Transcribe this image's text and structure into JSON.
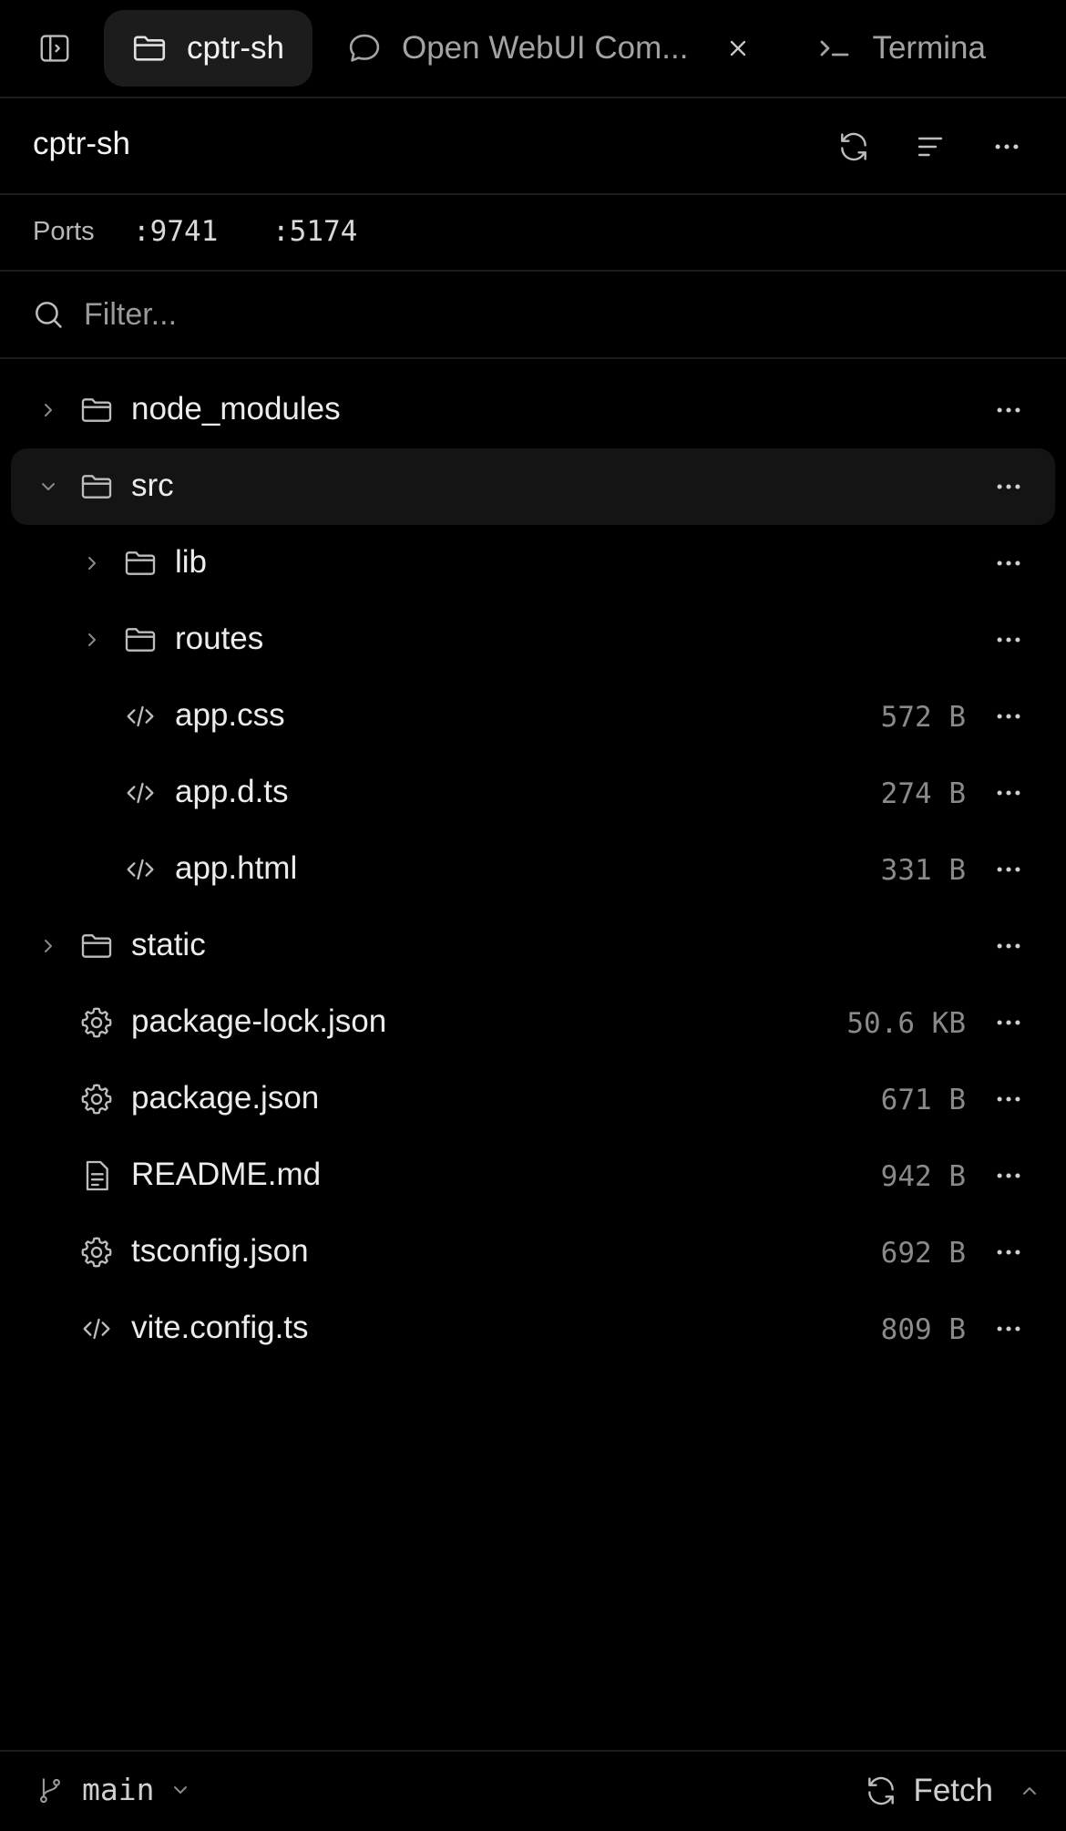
{
  "tabs": [
    {
      "label": "cptr-sh",
      "icon": "folder-icon",
      "active": true
    },
    {
      "label": "Open WebUI Com...",
      "icon": "chat-bubble-icon",
      "active": false,
      "closable": true
    },
    {
      "label": "Termina",
      "icon": "terminal-icon",
      "active": false
    }
  ],
  "header": {
    "title": "cptr-sh"
  },
  "ports": {
    "label": "Ports",
    "items": [
      ":9741",
      ":5174"
    ]
  },
  "filter": {
    "placeholder": "Filter...",
    "value": ""
  },
  "tree": [
    {
      "name": "node_modules",
      "type": "folder",
      "expanded": false,
      "depth": 0,
      "size": ""
    },
    {
      "name": "src",
      "type": "folder",
      "expanded": true,
      "depth": 0,
      "size": "",
      "selected": true
    },
    {
      "name": "lib",
      "type": "folder",
      "expanded": false,
      "depth": 1,
      "size": ""
    },
    {
      "name": "routes",
      "type": "folder",
      "expanded": false,
      "depth": 1,
      "size": ""
    },
    {
      "name": "app.css",
      "type": "code",
      "depth": 1,
      "size": "572 B"
    },
    {
      "name": "app.d.ts",
      "type": "code",
      "depth": 1,
      "size": "274 B"
    },
    {
      "name": "app.html",
      "type": "code",
      "depth": 1,
      "size": "331 B"
    },
    {
      "name": "static",
      "type": "folder",
      "expanded": false,
      "depth": 0,
      "size": ""
    },
    {
      "name": "package-lock.json",
      "type": "config",
      "depth": 0,
      "size": "50.6 KB"
    },
    {
      "name": "package.json",
      "type": "config",
      "depth": 0,
      "size": "671 B"
    },
    {
      "name": "README.md",
      "type": "doc",
      "depth": 0,
      "size": "942 B"
    },
    {
      "name": "tsconfig.json",
      "type": "config",
      "depth": 0,
      "size": "692 B"
    },
    {
      "name": "vite.config.ts",
      "type": "code",
      "depth": 0,
      "size": "809 B"
    }
  ],
  "footer": {
    "branch": "main",
    "fetch_label": "Fetch"
  },
  "colors": {
    "background": "#000000",
    "selected_row": "#141414",
    "active_tab": "#1c1c1c",
    "muted_text": "#8a8a8a"
  }
}
